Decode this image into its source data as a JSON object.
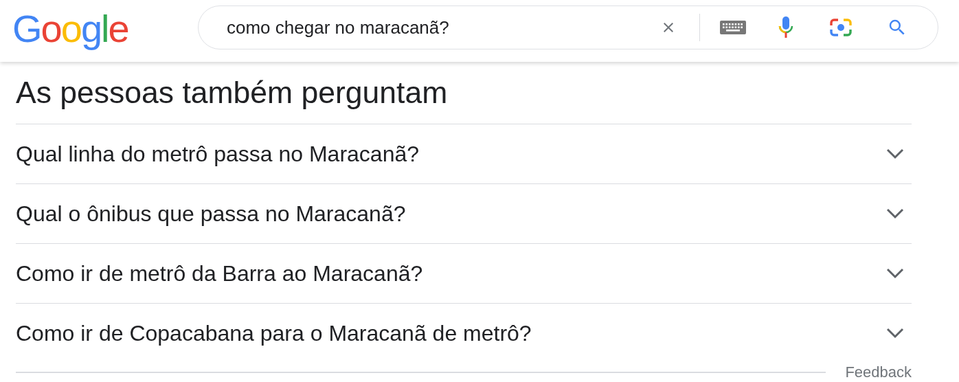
{
  "logo": "Google",
  "search": {
    "value": "como chegar no maracanã?"
  },
  "section": {
    "title": "As pessoas também perguntam",
    "questions": [
      {
        "text": "Qual linha do metrô passa no Maracanã?",
        "expanded": false
      },
      {
        "text": "Qual o ônibus que passa no Maracanã?",
        "expanded": false
      },
      {
        "text": "Como ir de metrô da Barra ao Maracanã?",
        "expanded": false
      },
      {
        "text": "Como ir de Copacabana para o Maracanã de metrô?",
        "expanded": false
      }
    ],
    "feedback": "Feedback"
  }
}
